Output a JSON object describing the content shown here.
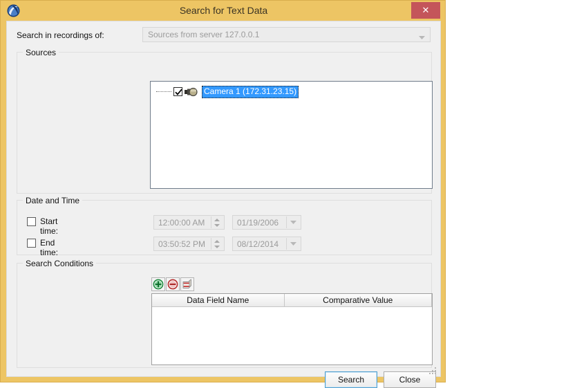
{
  "window": {
    "title": "Search for Text Data",
    "app_icon": "app-logo-icon",
    "close_label": "✕",
    "frame_color": "#edc564",
    "close_button_color": "#c4555a"
  },
  "top": {
    "search_in_label": "Search in recordings of:",
    "source_combo": {
      "value": "Sources from server 127.0.0.1",
      "enabled": false,
      "arrow_icon": "chevron-down-icon"
    }
  },
  "sources": {
    "caption": "Sources",
    "tree_items": [
      {
        "label": "Camera 1 (172.31.23.15)",
        "checked": true,
        "selected": true,
        "icon": "camera-icon",
        "selection_color": "#3399ff"
      }
    ]
  },
  "date_time": {
    "caption": "Date and Time",
    "rows": [
      {
        "label": "Start time:",
        "checked": false,
        "time_value": "12:00:00 AM",
        "date_value": "01/19/2006",
        "enabled": false
      },
      {
        "label": "End time:",
        "checked": false,
        "time_value": "03:50:52 PM",
        "date_value": "08/12/2014",
        "enabled": false
      }
    ]
  },
  "search_conditions": {
    "caption": "Search Conditions",
    "toolbar": [
      {
        "name": "add-condition-button",
        "icon": "plus-circle-icon",
        "color": "#1a8a3c"
      },
      {
        "name": "remove-condition-button",
        "icon": "minus-circle-icon",
        "color": "#c43030"
      },
      {
        "name": "clear-conditions-button",
        "icon": "clear-all-icon",
        "color": "#c43030"
      }
    ],
    "table": {
      "columns": [
        "Data Field Name",
        "Comparative Value"
      ],
      "rows": []
    }
  },
  "footer": {
    "search_label": "Search",
    "close_label": "Close",
    "resize_grip": "resize-grip-icon"
  }
}
